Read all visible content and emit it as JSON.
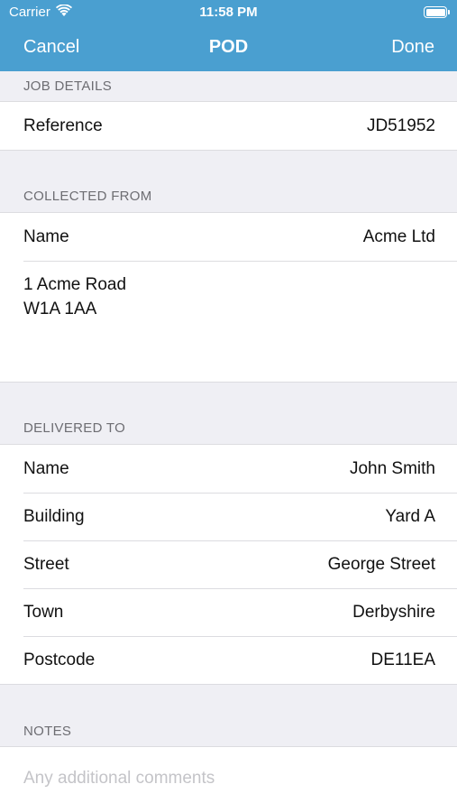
{
  "status_bar": {
    "carrier": "Carrier",
    "time": "11:58 PM"
  },
  "nav": {
    "cancel_label": "Cancel",
    "title": "POD",
    "done_label": "Done",
    "accent_color": "#4a9fd0"
  },
  "job_details": {
    "header": "JOB DETAILS",
    "rows": [
      {
        "label": "Reference",
        "value": "JD51952"
      }
    ]
  },
  "collected_from": {
    "header": "COLLECTED FROM",
    "rows": [
      {
        "label": "Name",
        "value": "Acme Ltd"
      }
    ],
    "address_lines": [
      "1 Acme Road",
      "W1A 1AA"
    ]
  },
  "delivered_to": {
    "header": "DELIVERED TO",
    "rows": [
      {
        "label": "Name",
        "value": "John Smith"
      },
      {
        "label": "Building",
        "value": "Yard A"
      },
      {
        "label": "Street",
        "value": "George Street"
      },
      {
        "label": "Town",
        "value": "Derbyshire"
      },
      {
        "label": "Postcode",
        "value": "DE11EA"
      }
    ]
  },
  "notes": {
    "header": "NOTES",
    "value": "",
    "placeholder": "Any additional comments"
  }
}
